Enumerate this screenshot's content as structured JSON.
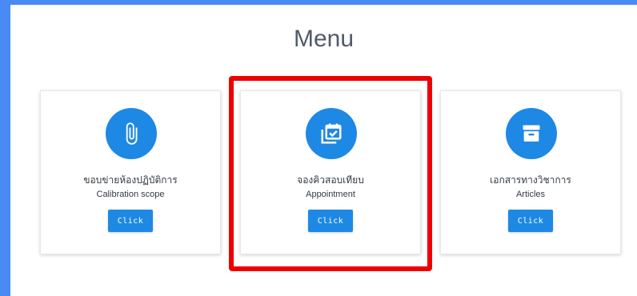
{
  "page": {
    "title": "Menu"
  },
  "cards": [
    {
      "title_th": "ขอบข่ายห้องปฏิบัติการ",
      "title_en": "Calibration scope",
      "button_label": "Click",
      "icon": "paperclip-icon"
    },
    {
      "title_th": "จองคิวสอบเทียบ",
      "title_en": "Appointment",
      "button_label": "Click",
      "icon": "calendar-check-icon"
    },
    {
      "title_th": "เอกสารทางวิชาการ",
      "title_en": "Articles",
      "button_label": "Click",
      "icon": "archive-box-icon"
    }
  ],
  "colors": {
    "accent": "#1e88e5",
    "frame": "#4a8af4",
    "highlight": "#ee0000",
    "title": "#4f5a6b"
  }
}
